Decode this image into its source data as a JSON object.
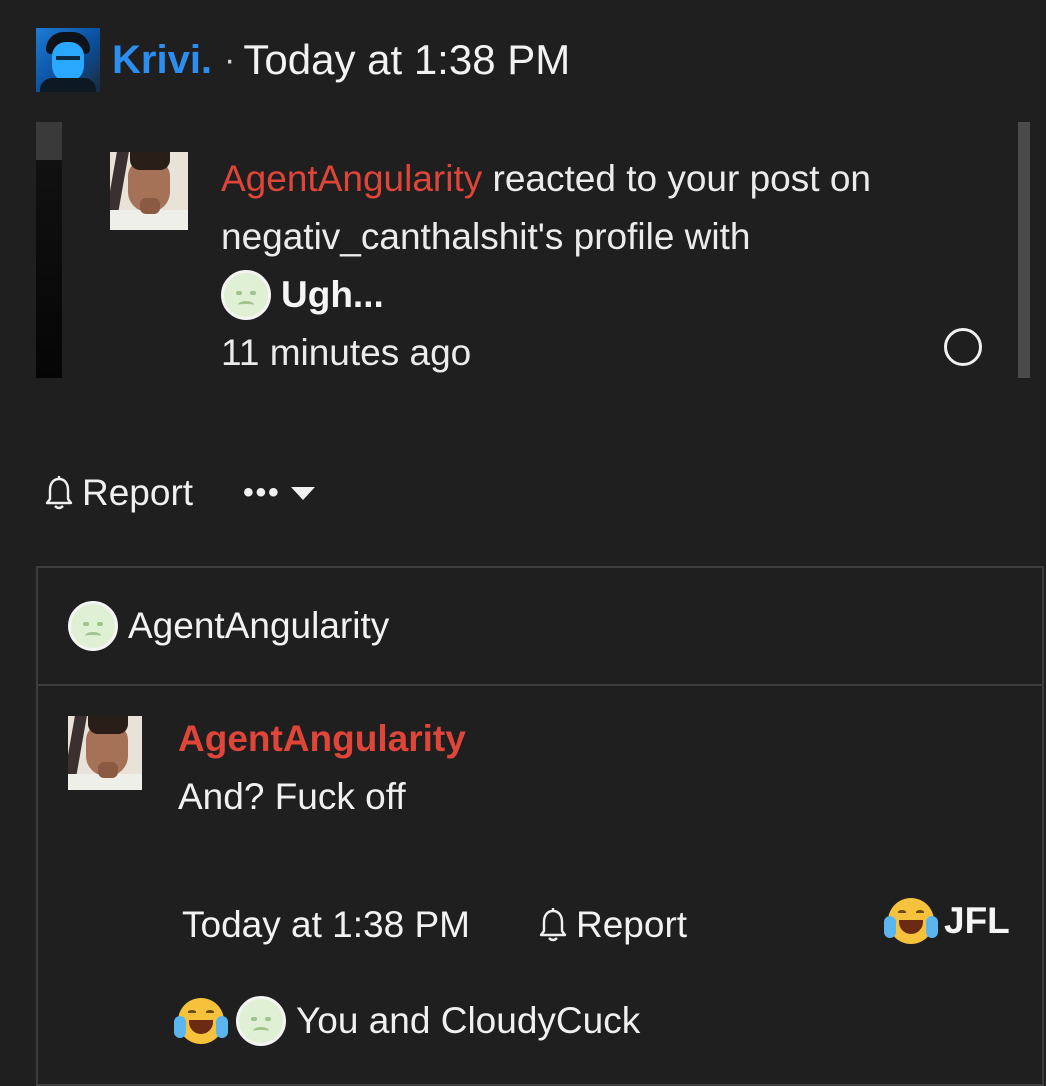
{
  "header": {
    "username": "Krivi.",
    "separator": "·",
    "timestamp": "Today at 1:38 PM",
    "avatar_icon": "user-avatar-blue"
  },
  "quoted_notification": {
    "actor": "AgentAngularity",
    "text_part1": " reacted to your post on",
    "text_part2": "negativ_canthalshit's profile with",
    "reaction_label": "Ugh...",
    "reaction_icon": "ugh-emoji-icon",
    "time_ago": "11 minutes ago",
    "mark_read_icon": "circle-icon"
  },
  "actions": {
    "report_label": "Report",
    "report_icon": "bell-icon",
    "more_label": "•••",
    "more_icon": "caret-down-icon"
  },
  "reply_box": {
    "reactor_name": "AgentAngularity",
    "message": {
      "author": "AgentAngularity",
      "text": "And? Fuck off",
      "timestamp": "Today at 1:38 PM",
      "report_label": "Report",
      "reaction_label": "JFL",
      "reaction_icon": "laughing-crying-emoji-icon"
    },
    "reactions_summary": "You and CloudyCuck"
  },
  "colors": {
    "background": "#1f1f1f",
    "link_blue": "#2b8ef0",
    "username_red": "#e0453a",
    "text": "#f0f0f0"
  }
}
